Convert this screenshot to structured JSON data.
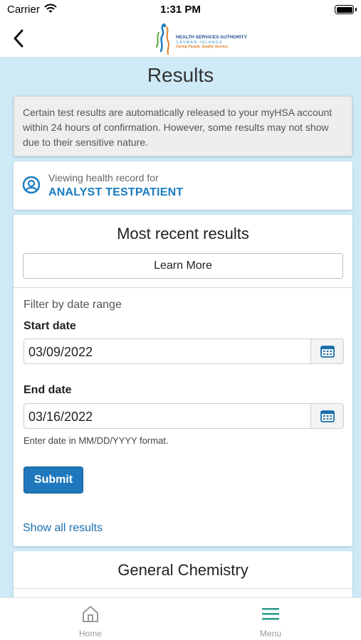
{
  "status_bar": {
    "carrier": "Carrier",
    "time": "1:31 PM"
  },
  "header": {
    "logo": {
      "title": "HEALTH SERVICES AUTHORITY",
      "subtitle": "CAYMAN ISLANDS",
      "tagline": "Caring People. Quality Service."
    }
  },
  "page": {
    "title": "Results"
  },
  "notice": {
    "text": "Certain test results are automatically released to your myHSA account within 24 hours of confirmation. However, some results may not show due to their sensitive nature."
  },
  "patient": {
    "label": "Viewing health record for",
    "name": "ANALYST TESTPATIENT"
  },
  "recent": {
    "title": "Most recent results",
    "learn_more": "Learn More",
    "filter_label": "Filter by date range",
    "start_label": "Start date",
    "start_value": "03/09/2022",
    "end_label": "End date",
    "end_value": "03/16/2022",
    "hint": "Enter date in MM/DD/YYYY format.",
    "submit": "Submit",
    "show_all": "Show all results"
  },
  "general": {
    "title": "General Chemistry"
  },
  "tabs": [
    {
      "label": "Home",
      "icon": "home-icon"
    },
    {
      "label": "Menu",
      "icon": "menu-icon"
    }
  ],
  "colors": {
    "background": "#cfeaf7",
    "accent": "#1a7cc1",
    "button": "#1f78bd",
    "menu_icon": "#2e9c8c"
  }
}
